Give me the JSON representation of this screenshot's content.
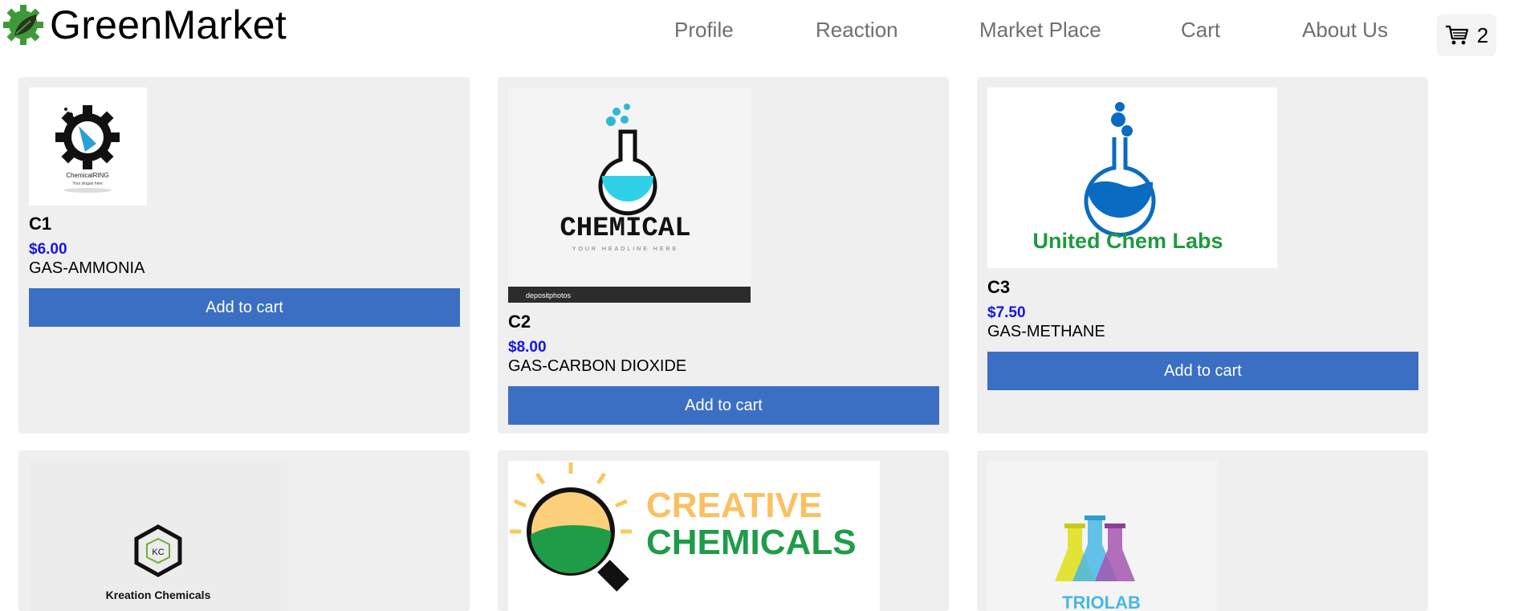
{
  "brand": {
    "name": "GreenMarket",
    "logo_icon": "gear-leaf-icon",
    "logo_color": "#3d9a3a"
  },
  "nav": [
    {
      "label": "Profile"
    },
    {
      "label": "Reaction"
    },
    {
      "label": "Market Place"
    },
    {
      "label": "Cart"
    },
    {
      "label": "About Us"
    }
  ],
  "cart": {
    "icon": "shopping-cart-icon",
    "count": "2"
  },
  "colors": {
    "accent_button": "#3b6fc3",
    "price": "#1414e6",
    "card_bg": "#efefef"
  },
  "products": [
    {
      "name": "C1",
      "price": "$6.00",
      "description": "GAS-AMMONIA",
      "button": "Add to cart",
      "logo_text": "ChemicalRING",
      "logo_tagline": "Your slogan here"
    },
    {
      "name": "C2",
      "price": "$8.00",
      "description": "GAS-CARBON DIOXIDE",
      "button": "Add to cart",
      "logo_text": "CHEMICAL",
      "logo_tagline": "YOUR HEADLINE HERE",
      "watermark": "depositphotos"
    },
    {
      "name": "C3",
      "price": "$7.50",
      "description": "GAS-METHANE",
      "button": "Add to cart",
      "logo_text": "United Chem Labs"
    },
    {
      "logo_text": "Kreation Chemicals",
      "logo_monogram": "KC"
    },
    {
      "logo_text_1": "CREATIVE",
      "logo_text_2": "CHEMICALS"
    },
    {
      "logo_text": "TRIOLAB"
    }
  ]
}
